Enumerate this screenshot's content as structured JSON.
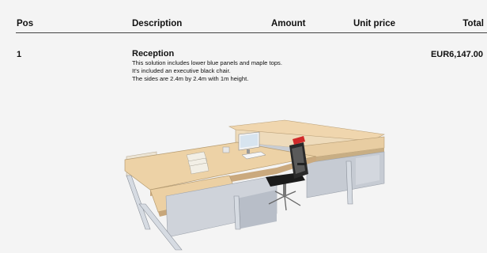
{
  "header": {
    "pos": "Pos",
    "description": "Description",
    "amount": "Amount",
    "unit_price": "Unit price",
    "total": "Total"
  },
  "items": [
    {
      "pos": "1",
      "title": "Reception",
      "lines": [
        "This solution includes lower blue panels and maple tops.",
        "It's included an executive black chair.",
        "The sides are 2.4m by 2.4m with 1m height."
      ],
      "total": "EUR6,147.00",
      "image": "reception-desk-render"
    }
  ],
  "colors": {
    "desk_top": "#ecd0a5",
    "panel": "#c7ccd3",
    "chair": "#1a1a1a",
    "headrest": "#d12a2a"
  }
}
